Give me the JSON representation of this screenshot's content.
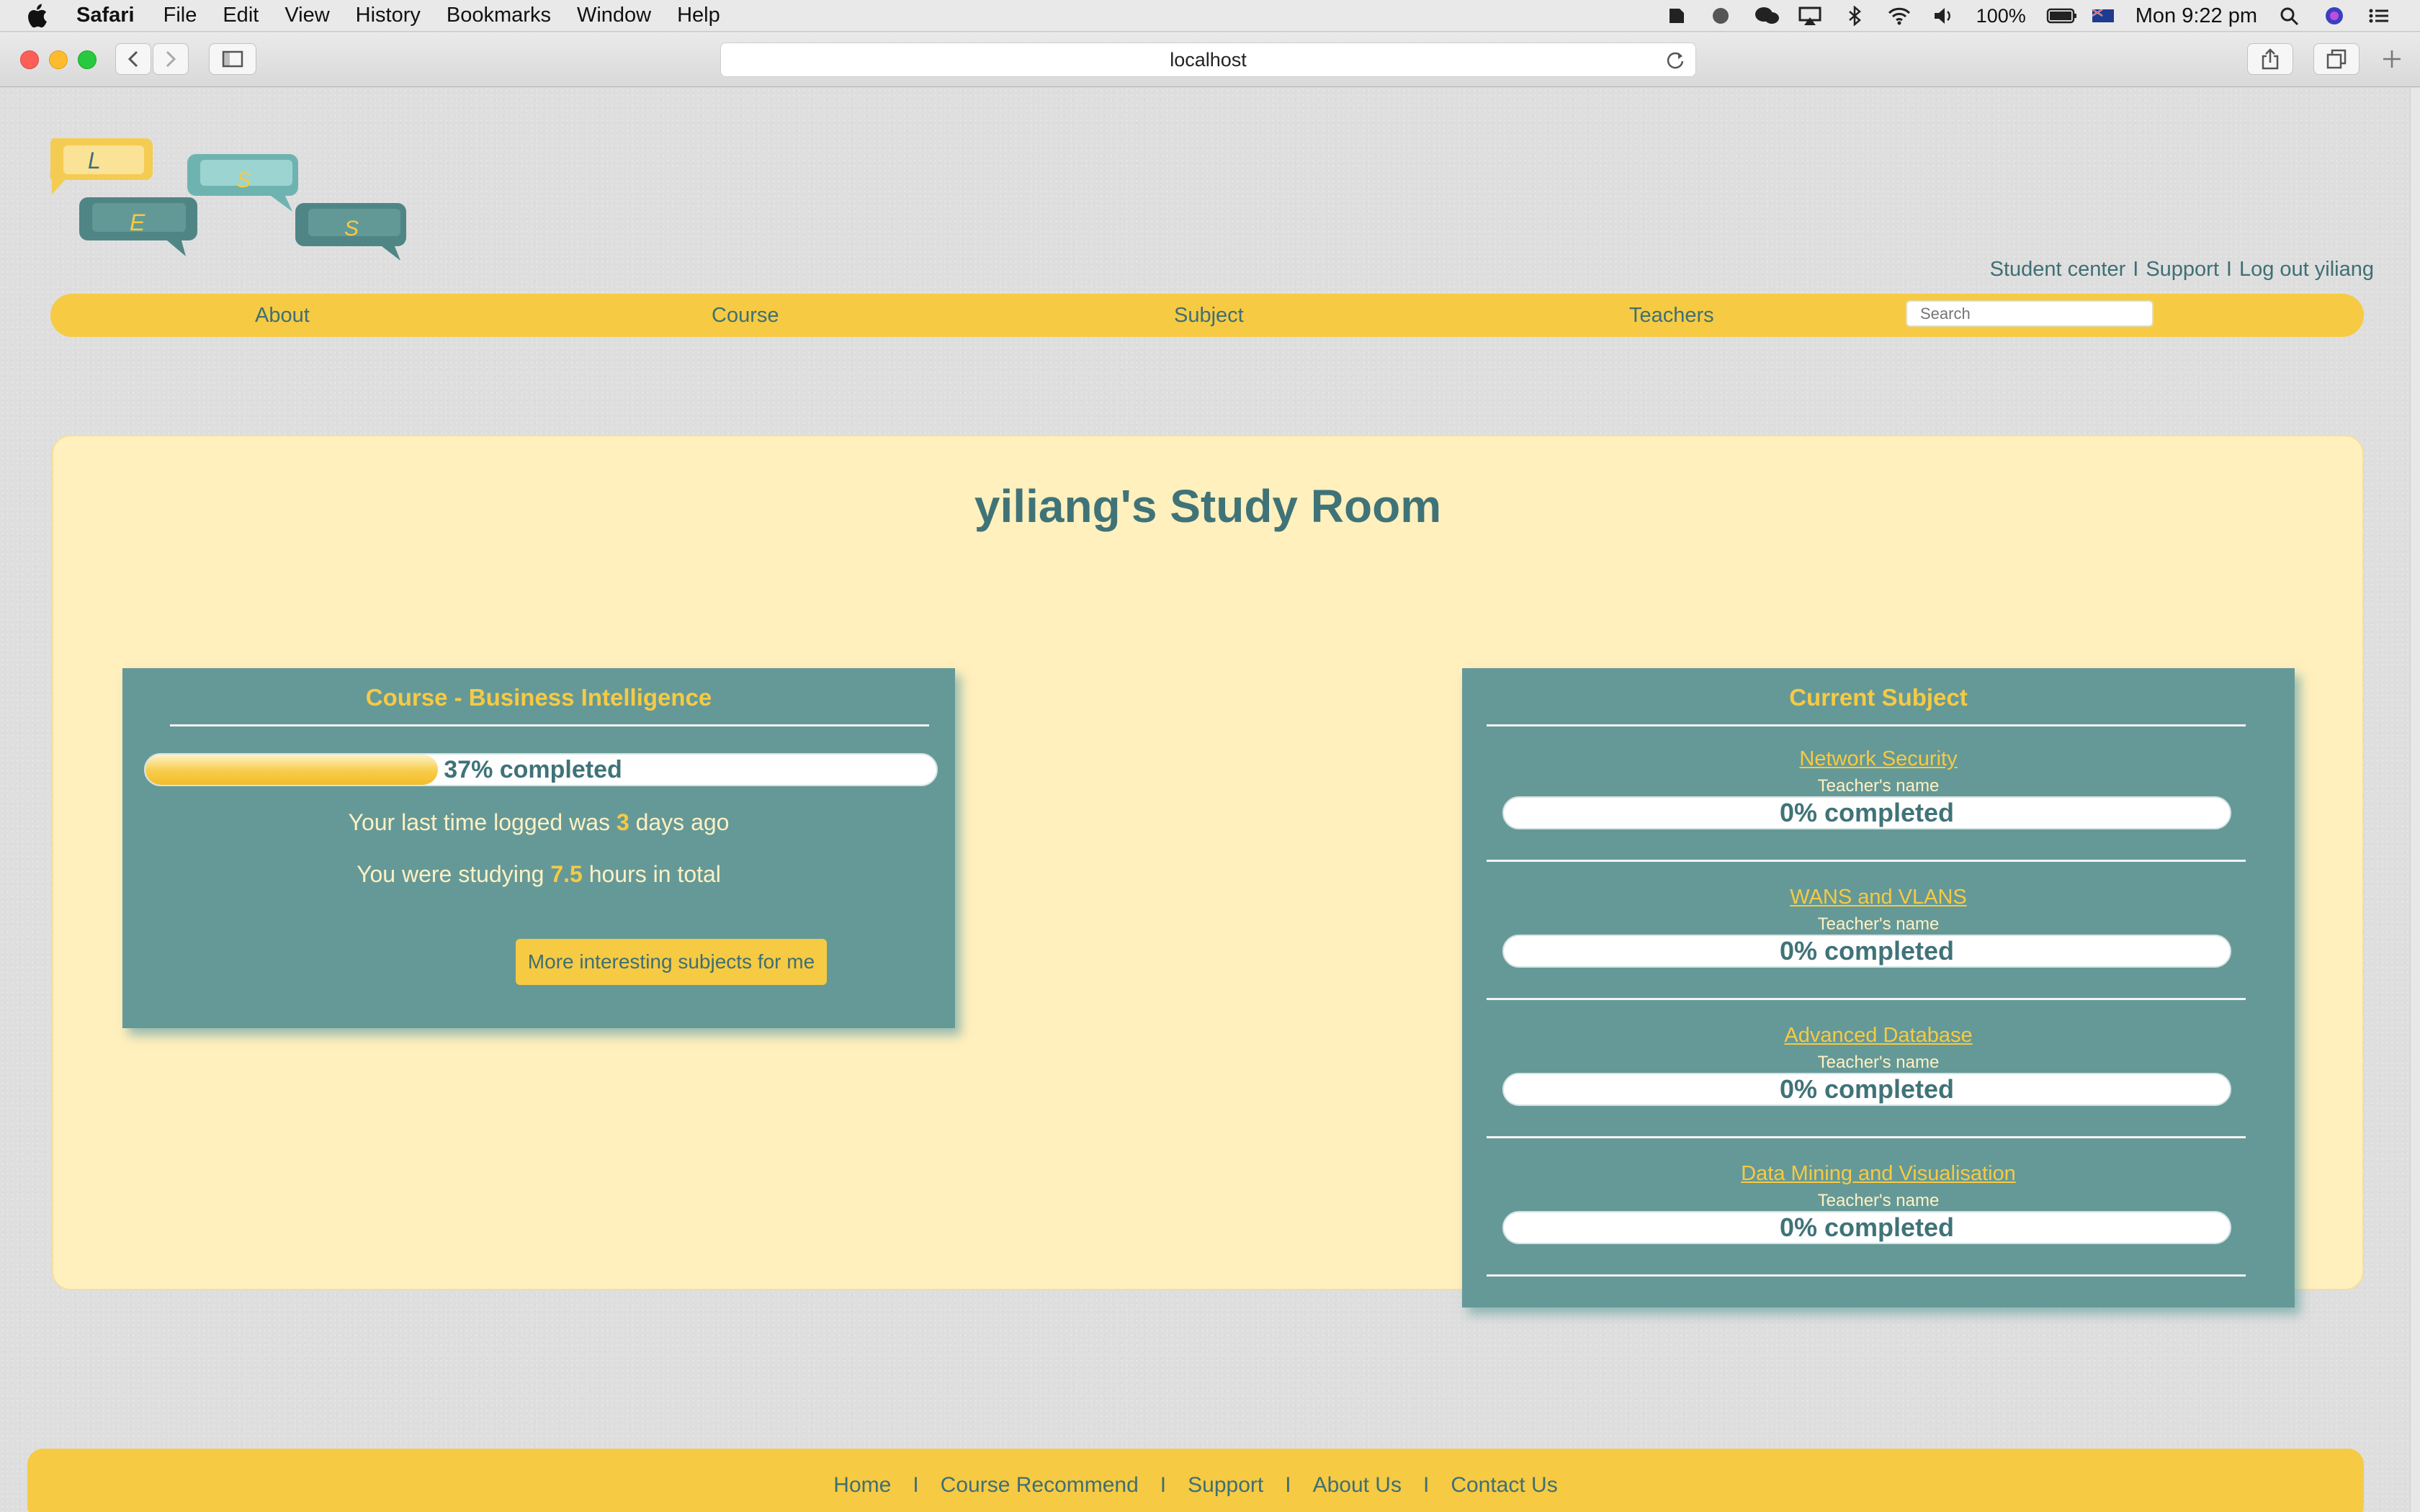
{
  "menubar": {
    "app_name": "Safari",
    "menus": [
      "File",
      "Edit",
      "View",
      "History",
      "Bookmarks",
      "Window",
      "Help"
    ],
    "battery": "100%",
    "clock": "Mon 9:22 pm"
  },
  "browser": {
    "url": "localhost"
  },
  "logo": {
    "letters": [
      "L",
      "E",
      "S",
      "S"
    ]
  },
  "toplinks": {
    "student_center": "Student center",
    "support": "Support",
    "logout": "Log out yiliang",
    "separator": "I"
  },
  "nav": {
    "items": [
      "About",
      "Course",
      "Subject",
      "Teachers"
    ],
    "search_placeholder": "Search"
  },
  "main": {
    "title": "yiliang's Study Room"
  },
  "course_card": {
    "title": "Course - Business Intelligence",
    "progress_percent": 37,
    "progress_label": "37% completed",
    "last_login_prefix": "Your last time logged was",
    "last_login_value": "3",
    "last_login_suffix": "days ago",
    "study_prefix": "You were studying",
    "study_value": "7.5",
    "study_suffix": "hours in total",
    "button_label": "More interesting subjects for me"
  },
  "subjects_card": {
    "title": "Current Subject",
    "subjects": [
      {
        "name": "Network Security",
        "teacher": "Teacher's name",
        "progress_percent": 0,
        "progress_label": "0% completed"
      },
      {
        "name": "WANS and VLANS",
        "teacher": "Teacher's name",
        "progress_percent": 0,
        "progress_label": "0% completed"
      },
      {
        "name": "Advanced Database",
        "teacher": "Teacher's name",
        "progress_percent": 0,
        "progress_label": "0% completed"
      },
      {
        "name": "Data Mining and Visualisation",
        "teacher": "Teacher's name",
        "progress_percent": 0,
        "progress_label": "0% completed"
      }
    ]
  },
  "footer": {
    "links": [
      "Home",
      "Course Recommend",
      "Support",
      "About Us",
      "Contact Us"
    ],
    "separator": "I"
  },
  "colors": {
    "accent_yellow": "#f6ca43",
    "teal": "#659997",
    "text_teal": "#3e6f73",
    "panel_cream": "#fff0be"
  }
}
